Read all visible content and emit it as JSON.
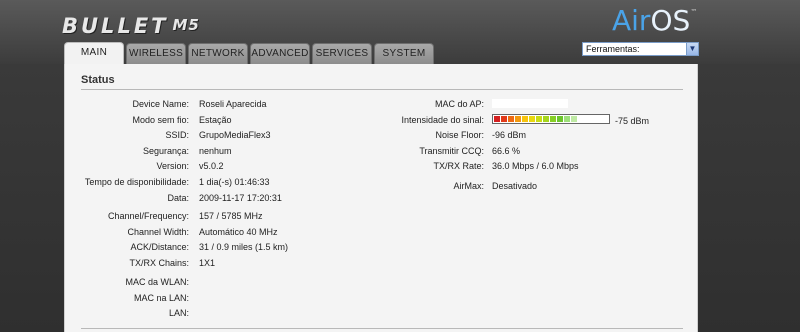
{
  "brand": {
    "product": "BULLET",
    "model": "M5",
    "os_a": "Air",
    "os_b": "OS",
    "tm": "™"
  },
  "tools": {
    "selected": "Ferramentas:"
  },
  "tabs": [
    {
      "label": "MAIN",
      "active": true
    },
    {
      "label": "WIRELESS",
      "active": false
    },
    {
      "label": "NETWORK",
      "active": false
    },
    {
      "label": "ADVANCED",
      "active": false
    },
    {
      "label": "SERVICES",
      "active": false
    },
    {
      "label": "SYSTEM",
      "active": false
    }
  ],
  "status": {
    "title": "Status",
    "left": [
      {
        "label": "Device Name:",
        "value": "Roseli Aparecida"
      },
      {
        "label": "Modo sem fio:",
        "value": "Estação"
      },
      {
        "label": "SSID:",
        "value": "GrupoMediaFlex3"
      },
      {
        "label": "Segurança:",
        "value": "nenhum"
      },
      {
        "label": "Version:",
        "value": "v5.0.2"
      },
      {
        "label": "Tempo de disponibilidade:",
        "value": "1 dia(-s) 01:46:33"
      },
      {
        "label": "Data:",
        "value": "2009-11-17 17:20:31"
      },
      {
        "label": "Channel/Frequency:",
        "value": "157 / 5785 MHz"
      },
      {
        "label": "Channel Width:",
        "value": "Automático 40 MHz"
      },
      {
        "label": "ACK/Distance:",
        "value": "31 / 0.9 miles (1.5 km)"
      },
      {
        "label": "TX/RX Chains:",
        "value": "1X1"
      },
      {
        "label": "MAC da WLAN:",
        "value": ""
      },
      {
        "label": "MAC na LAN:",
        "value": ""
      },
      {
        "label": "LAN:",
        "value": ""
      }
    ],
    "right": [
      {
        "label": "MAC do AP:",
        "value": ""
      },
      {
        "label": "Intensidade do sinal:",
        "value": "-75 dBm"
      },
      {
        "label": "Noise Floor:",
        "value": "-96 dBm"
      },
      {
        "label": "Transmitir CCQ:",
        "value": "66.6 %"
      },
      {
        "label": "TX/RX Rate:",
        "value": "36.0 Mbps  / 6.0 Mbps"
      },
      {
        "label": "AirMax:",
        "value": "Desativado"
      }
    ],
    "signal": {
      "level": 0.72,
      "segment_colors": [
        "#d42020",
        "#e23a1a",
        "#ee6a14",
        "#f39a10",
        "#f7c40e",
        "#e9d80f",
        "#c9dc14",
        "#a6d61c",
        "#86cf25",
        "#6cc52c",
        "#9ee07a",
        "#bfeaa4"
      ]
    }
  }
}
